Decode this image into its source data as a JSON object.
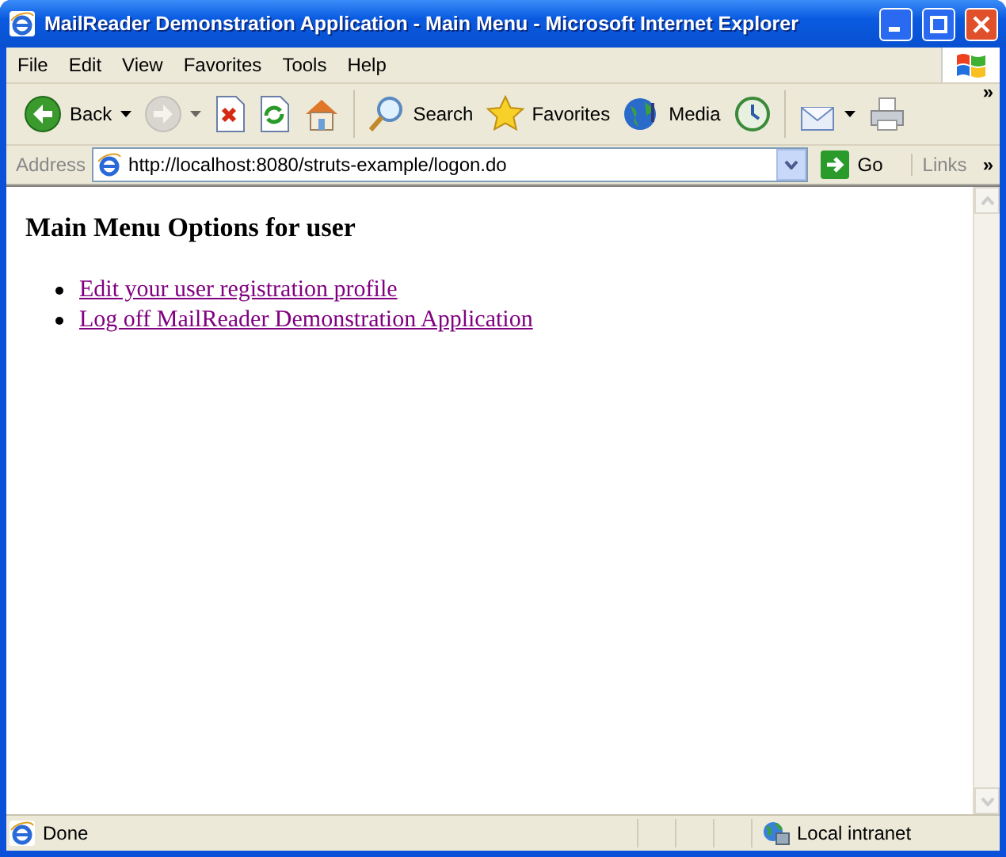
{
  "window": {
    "title": "MailReader Demonstration Application - Main Menu - Microsoft Internet Explorer"
  },
  "menu": [
    "File",
    "Edit",
    "View",
    "Favorites",
    "Tools",
    "Help"
  ],
  "toolbar": {
    "buttons": [
      {
        "kind": "back",
        "label": "Back",
        "dropdown": true,
        "disabled": false
      },
      {
        "kind": "forward",
        "dropdown": true,
        "disabled": true
      },
      {
        "kind": "stop",
        "dropdown": false,
        "disabled": false
      },
      {
        "kind": "refresh",
        "dropdown": false,
        "disabled": false
      },
      {
        "kind": "home",
        "dropdown": false,
        "disabled": false
      },
      {
        "kind": "search",
        "label": "Search",
        "dropdown": false,
        "disabled": false
      },
      {
        "kind": "favorites",
        "label": "Favorites",
        "dropdown": false,
        "disabled": false
      },
      {
        "kind": "media",
        "label": "Media",
        "dropdown": false,
        "disabled": false
      },
      {
        "kind": "history",
        "dropdown": false,
        "disabled": false
      },
      {
        "kind": "mail",
        "dropdown": true,
        "disabled": false
      },
      {
        "kind": "print",
        "dropdown": false,
        "disabled": false
      }
    ],
    "more": "»"
  },
  "address": {
    "label": "Address",
    "value": "http://localhost:8080/struts-example/logon.do",
    "go": "Go",
    "links": "Links",
    "more": "»"
  },
  "page": {
    "heading": "Main Menu Options for user",
    "links": [
      "Edit your user registration profile",
      "Log off MailReader Demonstration Application"
    ]
  },
  "status_bar": {
    "text": "Done",
    "zone": "Local intranet"
  }
}
